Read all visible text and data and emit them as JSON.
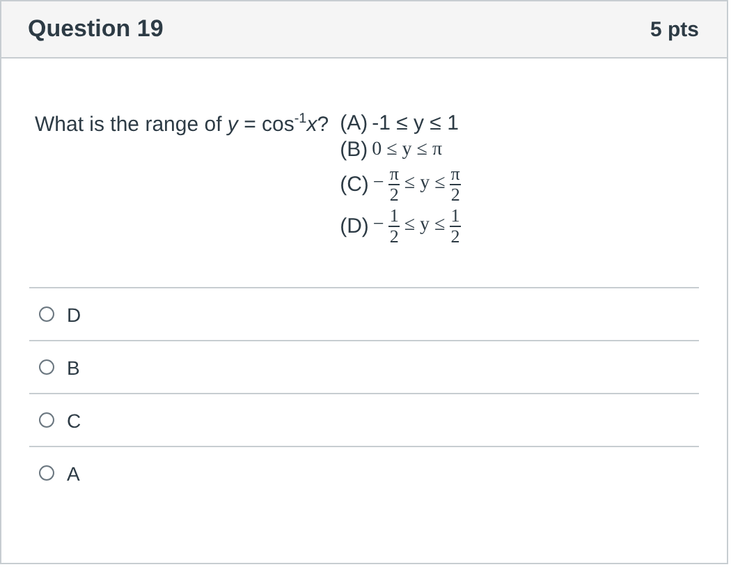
{
  "header": {
    "title": "Question 19",
    "points": "5 pts"
  },
  "question": {
    "prompt": "What is the range of *y* = cos$^{-1}$*x*?",
    "choices": [
      {
        "label": "(A)",
        "parts": [
          {
            "kind": "text",
            "text": "-1 ≤ y ≤ 1"
          }
        ]
      },
      {
        "label": "(B)",
        "parts": [
          {
            "kind": "math",
            "text": "0 ≤ y ≤ π"
          }
        ]
      },
      {
        "label": "(C)",
        "parts": [
          {
            "kind": "math",
            "text": "−"
          },
          {
            "kind": "frac",
            "num": "π",
            "den": "2"
          },
          {
            "kind": "math",
            "text": "≤ y ≤"
          },
          {
            "kind": "frac",
            "num": "π",
            "den": "2"
          }
        ]
      },
      {
        "label": "(D)",
        "parts": [
          {
            "kind": "math",
            "text": "−"
          },
          {
            "kind": "frac",
            "num": "1",
            "den": "2"
          },
          {
            "kind": "math",
            "text": "≤ y ≤"
          },
          {
            "kind": "frac",
            "num": "1",
            "den": "2"
          }
        ]
      }
    ]
  },
  "answers": [
    {
      "label": "D",
      "selected": false
    },
    {
      "label": "B",
      "selected": false
    },
    {
      "label": "C",
      "selected": false
    },
    {
      "label": "A",
      "selected": false
    }
  ]
}
